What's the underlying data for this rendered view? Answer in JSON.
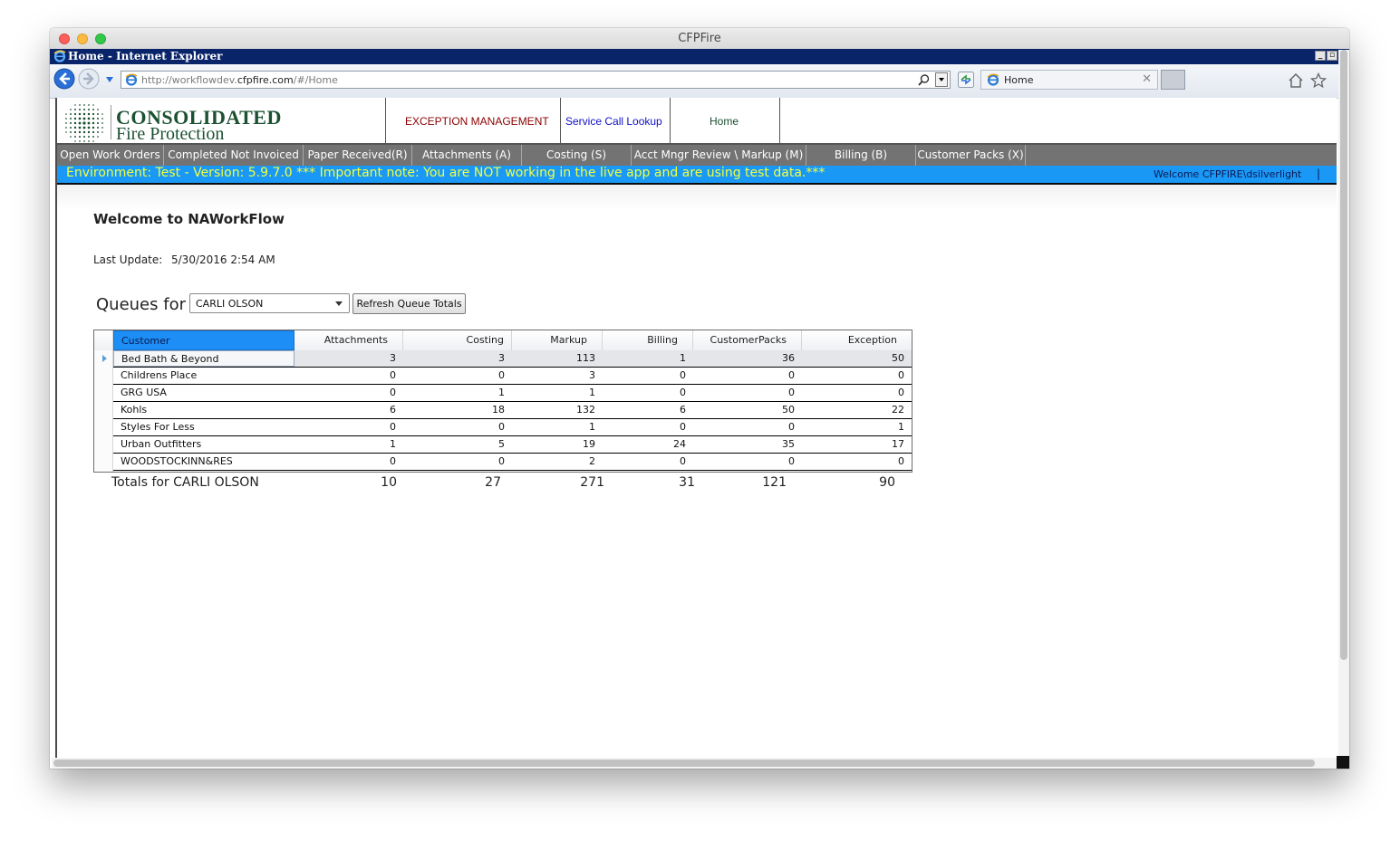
{
  "mac_window": {
    "title": "CFPFire"
  },
  "ie": {
    "window_title": "Home - Internet Explorer",
    "url_prefix": "http://workflowdev.",
    "url_domain": "cfpfire.com",
    "url_suffix": "/#/Home",
    "tab_title": "Home"
  },
  "header": {
    "brand_line1": "CONSOLIDATED",
    "brand_line2": "Fire Protection",
    "links": [
      "EXCEPTION MANAGEMENT",
      "Service Call Lookup",
      "Home"
    ],
    "link_colors": [
      "#8b0000",
      "#1010c8",
      "#1b5131"
    ]
  },
  "menu": {
    "items": [
      "Open Work Orders",
      "Completed Not Invoiced",
      "Paper Received(R)",
      "Attachments (A)",
      "Costing (S)",
      "Acct Mngr Review \\ Markup (M)",
      "Billing (B)",
      "Customer Packs (X)"
    ]
  },
  "env": {
    "text": "Environment: Test - Version: 5.9.7.0 *** Important note: You are NOT working in the live app and are using test data.***",
    "welcome": "Welcome CFPFIRE\\dsilverlight",
    "pipe": "|",
    "bar_color": "#1a98f5",
    "text_color": "#f4ff3c"
  },
  "main": {
    "title": "Welcome to NAWorkFlow",
    "last_update_label": "Last Update:",
    "last_update_value": "5/30/2016 2:54 AM",
    "queues_label": "Queues for",
    "selected_user": "CARLI OLSON",
    "refresh_label": "Refresh Queue Totals"
  },
  "grid": {
    "columns": [
      "Customer",
      "Attachments",
      "Costing",
      "Markup",
      "Billing",
      "CustomerPacks",
      "Exception"
    ],
    "rows": [
      [
        "Bed Bath & Beyond",
        "3",
        "3",
        "113",
        "1",
        "36",
        "50"
      ],
      [
        "Childrens Place",
        "0",
        "0",
        "3",
        "0",
        "0",
        "0"
      ],
      [
        "GRG USA",
        "0",
        "1",
        "1",
        "0",
        "0",
        "0"
      ],
      [
        "Kohls",
        "6",
        "18",
        "132",
        "6",
        "50",
        "22"
      ],
      [
        "Styles For Less",
        "0",
        "0",
        "1",
        "0",
        "0",
        "1"
      ],
      [
        "Urban Outfitters",
        "1",
        "5",
        "19",
        "24",
        "35",
        "17"
      ],
      [
        "WOODSTOCKINN&RES",
        "0",
        "0",
        "2",
        "0",
        "0",
        "0"
      ]
    ],
    "selected_row": 0
  },
  "totals": {
    "label": "Totals for CARLI OLSON",
    "values": [
      "10",
      "27",
      "271",
      "31",
      "121",
      "90"
    ]
  }
}
